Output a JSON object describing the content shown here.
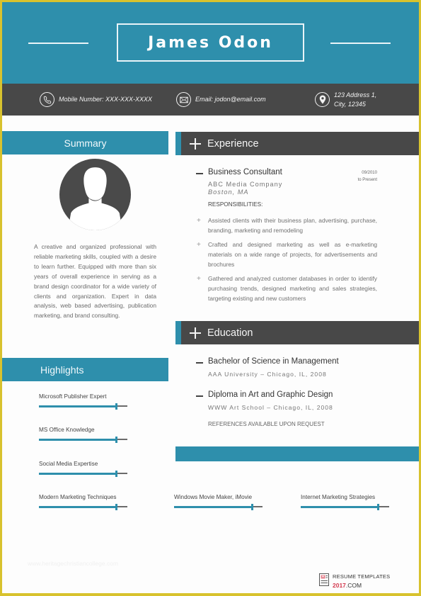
{
  "header": {
    "name": "James Odon"
  },
  "contact": {
    "phone": {
      "icon": "phone-icon",
      "text": "Mobile Number: XXX-XXX-XXXX"
    },
    "email": {
      "icon": "envelope-icon",
      "text": "Email: jodon@email.com"
    },
    "address": {
      "icon": "location-pin-icon",
      "line1": "123 Address 1,",
      "line2": "City, 12345"
    }
  },
  "summary": {
    "heading": "Summary",
    "avatar_icon": "user-avatar-icon",
    "text": "A creative and organized professional with reliable marketing skills, coupled with a desire to learn further. Equipped with more than six years of overall experience in serving as a brand design coordinator for a wide variety of clients and organization. Expert in data analysis, web based advertising, publication marketing, and brand consulting."
  },
  "experience": {
    "heading": "Experience",
    "jobs": [
      {
        "title": "Business Consultant",
        "company": "ABC Media Company",
        "location": "Boston, MA",
        "date_start": "09/2010",
        "date_end": "to Present",
        "responsibilities_label": "RESPONSIBILITIES:",
        "responsibilities": [
          "Assisted clients with their business plan, advertising, purchase, branding, marketing and remodeling",
          "Crafted and designed marketing as well as e-marketing materials on a wide range of projects, for advertisements and brochures",
          "Gathered and analyzed customer databases in order to identify purchasing trends, designed marketing and sales strategies, targeting existing and new customers"
        ]
      }
    ]
  },
  "education": {
    "heading": "Education",
    "items": [
      {
        "degree": "Bachelor of Science in Management",
        "school": "AAA University – Chicago, IL, 2008"
      },
      {
        "degree": "Diploma in Art and Graphic Design",
        "school": "WWW Art School – Chicago, IL, 2008"
      }
    ],
    "references": "REFERENCES AVAILABLE UPON REQUEST"
  },
  "highlights": {
    "heading": "Highlights",
    "skills": [
      {
        "label": "Microsoft Publisher Expert",
        "level": 0.87
      },
      {
        "label": "MS Office Knowledge",
        "level": 0.87
      },
      {
        "label": "Social Media Expertise",
        "level": 0.87
      },
      {
        "label": "Modern Marketing Techniques",
        "level": 0.87
      },
      {
        "label": "Windows Movie Maker, iMovie",
        "level": 0.88
      },
      {
        "label": "Internet Marketing Strategies",
        "level": 0.87
      }
    ]
  },
  "footer": {
    "watermark": "www.heritagechristiancollege.com",
    "logo_top": "RESUME TEMPLATES",
    "logo_year": "2017",
    "logo_suffix": ".COM"
  },
  "colors": {
    "accent": "#2e8fac",
    "dark": "#484848",
    "frame": "#d8c22e",
    "logo_red": "#d33a4f"
  }
}
